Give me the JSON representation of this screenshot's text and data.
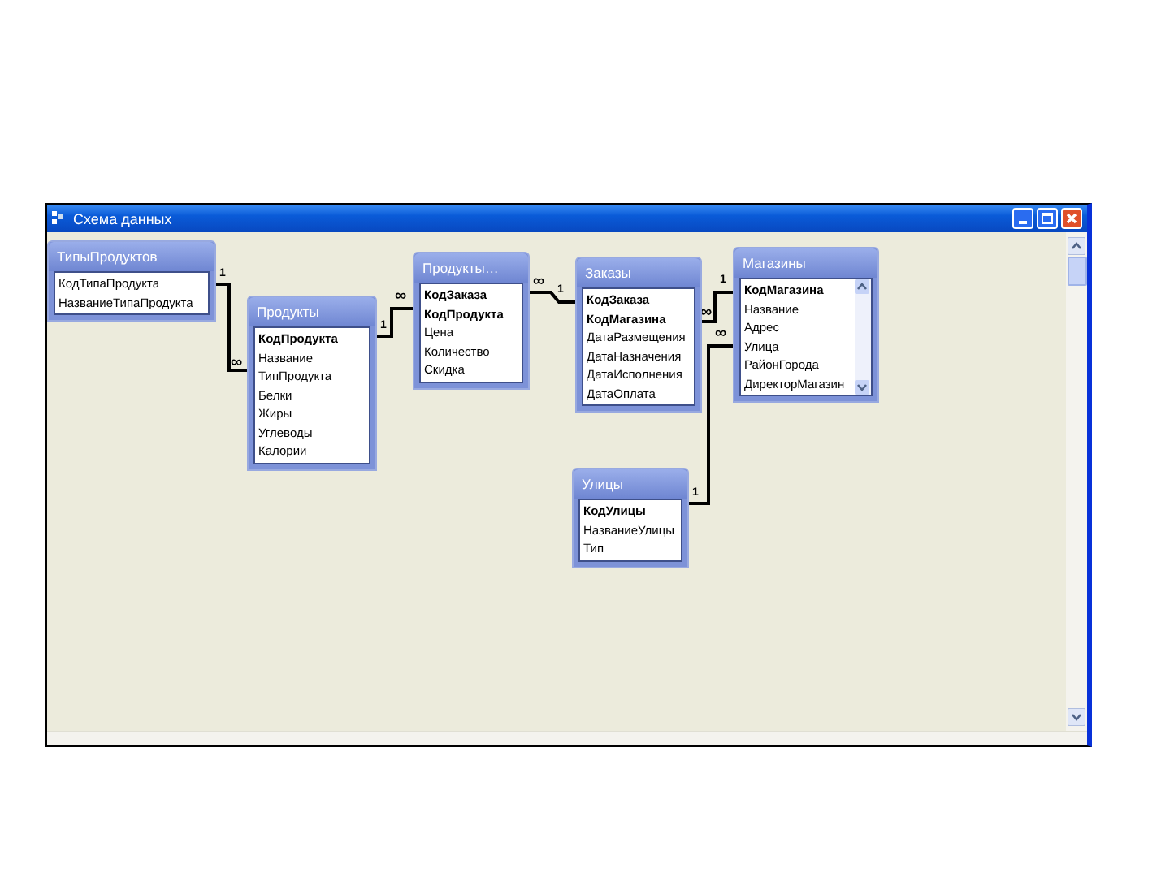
{
  "window": {
    "title": "Схема данных"
  },
  "tables": [
    {
      "title": "ТипыПродуктов",
      "kind": "plain",
      "fields": [
        {
          "name": "КодТипаПродукта",
          "key": false
        },
        {
          "name": "НазваниеТипаПродукта",
          "key": false
        }
      ]
    },
    {
      "title": "Продукты",
      "kind": "plain",
      "fields": [
        {
          "name": "КодПродукта",
          "key": true
        },
        {
          "name": "Название",
          "key": false
        },
        {
          "name": "ТипПродукта",
          "key": false
        },
        {
          "name": "Белки",
          "key": false
        },
        {
          "name": "Жиры",
          "key": false
        },
        {
          "name": "Углеводы",
          "key": false
        },
        {
          "name": "Калории",
          "key": false
        }
      ]
    },
    {
      "title": "Продукты…",
      "kind": "plain",
      "fields": [
        {
          "name": "КодЗаказа",
          "key": true
        },
        {
          "name": "КодПродукта",
          "key": true
        },
        {
          "name": "Цена",
          "key": false
        },
        {
          "name": "Количество",
          "key": false
        },
        {
          "name": "Скидка",
          "key": false
        }
      ]
    },
    {
      "title": "Заказы",
      "kind": "plain",
      "fields": [
        {
          "name": "КодЗаказа",
          "key": true
        },
        {
          "name": "КодМагазина",
          "key": true
        },
        {
          "name": "ДатаРазмещения",
          "key": false
        },
        {
          "name": "ДатаНазначения",
          "key": false
        },
        {
          "name": "ДатаИсполнения",
          "key": false
        },
        {
          "name": "ДатаОплата",
          "key": false
        }
      ]
    },
    {
      "title": "Магазины",
      "kind": "scrolled",
      "fields": [
        {
          "name": "КодМагазина",
          "key": true
        },
        {
          "name": "Название",
          "key": false
        },
        {
          "name": "Адрес",
          "key": false
        },
        {
          "name": "Улица",
          "key": false
        },
        {
          "name": "РайонГорода",
          "key": false
        },
        {
          "name": "ДиректорМагазин",
          "key": false
        }
      ]
    },
    {
      "title": "Улицы",
      "kind": "plain",
      "fields": [
        {
          "name": "КодУлицы",
          "key": true
        },
        {
          "name": "НазваниеУлицы",
          "key": false
        },
        {
          "name": "Тип",
          "key": false
        }
      ]
    }
  ],
  "relationships": [
    {
      "one": "1",
      "many": "∞"
    },
    {
      "one": "1",
      "many": "∞"
    },
    {
      "one": "1",
      "many": "∞"
    },
    {
      "one": "1",
      "many": "∞"
    },
    {
      "one": "1",
      "many": "∞"
    }
  ]
}
